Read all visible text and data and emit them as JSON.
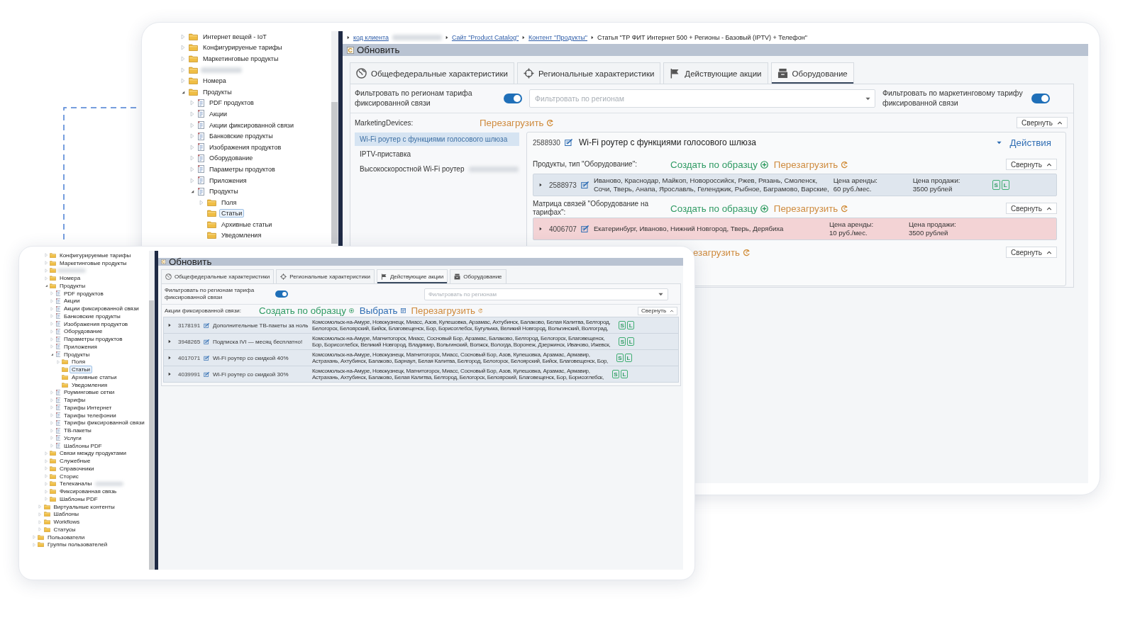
{
  "back_window": {
    "tree": [
      {
        "label": "Интернет вещей - IoT",
        "kind": "folder",
        "expandable": true,
        "expanded": false,
        "selected": false
      },
      {
        "label": "Конфигурируеные тарифы",
        "kind": "folder",
        "expandable": true,
        "expanded": false,
        "selected": false
      },
      {
        "label": "Маркетинговые продукты",
        "kind": "folder",
        "expandable": true,
        "expanded": false,
        "selected": false
      },
      {
        "kind": "folder",
        "expandable": true,
        "expanded": false,
        "redacted": true
      },
      {
        "label": "Номера",
        "kind": "folder",
        "expandable": true,
        "expanded": false,
        "selected": false
      },
      {
        "label": "Продукты",
        "kind": "folder",
        "expandable": true,
        "expanded": true,
        "selected": false,
        "children": [
          {
            "label": "PDF продуктов",
            "kind": "doc",
            "expandable": true,
            "expanded": false,
            "selected": false
          },
          {
            "label": "Акции",
            "kind": "doc",
            "expandable": true,
            "expanded": false,
            "selected": false
          },
          {
            "label": "Акции фиксированной связи",
            "kind": "doc",
            "expandable": true,
            "expanded": false,
            "selected": false
          },
          {
            "label": "Банковские продукты",
            "kind": "doc",
            "expandable": true,
            "expanded": false,
            "selected": false
          },
          {
            "label": "Изображения продуктов",
            "kind": "doc",
            "expandable": true,
            "expanded": false,
            "selected": false
          },
          {
            "label": "Оборудование",
            "kind": "doc",
            "expandable": true,
            "expanded": false,
            "selected": false
          },
          {
            "label": "Параметры продуктов",
            "kind": "doc",
            "expandable": true,
            "expanded": false,
            "selected": false
          },
          {
            "label": "Приложения",
            "kind": "doc",
            "expandable": true,
            "expanded": false,
            "selected": false
          },
          {
            "label": "Продукты",
            "kind": "doc",
            "expandable": true,
            "expanded": true,
            "selected": false,
            "children": [
              {
                "label": "Поля",
                "kind": "folder",
                "expandable": true,
                "expanded": false,
                "selected": false
              },
              {
                "label": "Статьи",
                "kind": "folder",
                "expandable": false,
                "selected": true
              },
              {
                "label": "Архивные статьи",
                "kind": "folder",
                "expandable": false,
                "selected": false
              },
              {
                "label": "Уведомления",
                "kind": "folder",
                "expandable": false,
                "selected": false
              }
            ]
          }
        ]
      }
    ],
    "breadcrumb": [
      {
        "text": "код клиента",
        "kind": "link",
        "redacted": true
      },
      {
        "text": "Сайт \"Product Catalog\"",
        "kind": "link"
      },
      {
        "text": "Контент \"Продукты\"",
        "kind": "link"
      },
      {
        "text": "Статья \"ТР ФИТ Интернет 500 + Регионы - Базовый (IPTV) + Телефон\"",
        "kind": "current"
      }
    ],
    "toolbar": {
      "refresh": "Обновить"
    },
    "tabs": [
      {
        "label": "Общефедеральные характеристики",
        "selected": false
      },
      {
        "label": "Региональные характеристики",
        "selected": false
      },
      {
        "label": "Действующие акции",
        "selected": false
      },
      {
        "label": "Оборудование",
        "selected": true
      }
    ],
    "filters": {
      "region_label": "Фильтровать по регионам тарифа фиксированной связи",
      "region_toggle_on": true,
      "region_placeholder": "Фильтровать по регионам",
      "marketing_label": "Фильтровать по маркетинговому тарифу фиксированной связи",
      "marketing_toggle_on": true
    },
    "devices": {
      "label": "MarketingDevices:",
      "reload": "Перезагрузить",
      "collapse": "Свернуть",
      "items": [
        {
          "label": "Wi-Fi роутер с функциями голосового шлюза",
          "selected": true,
          "redacted": false
        },
        {
          "label": "IPTV-приставка",
          "selected": false,
          "redacted": false
        },
        {
          "label": "Высокоскоростной Wi-Fi роутер",
          "selected": false,
          "redacted": true
        }
      ]
    },
    "detail": {
      "id": "2588930",
      "title": "Wi-Fi роутер с функциями голосового шлюза",
      "actions": "Действия",
      "sections": [
        {
          "label": "Продукты, тип \"Оборудование\":",
          "create": "Создать по образцу",
          "reload": "Перезагрузить",
          "collapse": "Свернуть",
          "rows": [
            {
              "id": "2588973",
              "regions": [
                "Иваново, Краснодар, Майкоп, Новороссийск, Ржев, Рязань, Смоленск,",
                "Сочи, Тверь, Анапа, Ярославль, Геленджик, Рыбное, Баграмово, Варские,"
              ],
              "rent_label": "Цена аренды:",
              "rent": "60 руб./мес.",
              "sale_label": "Цена продажи:",
              "sale": "3500 рублей",
              "badges": [
                "S",
                "L"
              ],
              "color": "#dfe6ee"
            }
          ]
        },
        {
          "label": "Матрица связей \"Оборудование на тарифах\":",
          "create": "Создать по образцу",
          "reload": "Перезагрузить",
          "collapse": "Свернуть",
          "rows": [
            {
              "id": "4006707",
              "regions": [
                "Екатеринбург, Иваново, Нижний Новгород, Тверь, Дерябиха"
              ],
              "rent_label": "Цена аренды:",
              "rent": "10 руб./мес.",
              "sale_label": "Цена продажи:",
              "sale": "3500 рублей",
              "color": "#f3d3d5"
            }
          ]
        },
        {
          "reload": "езагрузить",
          "collapse": "Свернуть"
        }
      ]
    }
  },
  "front_window": {
    "tree": [
      {
        "children": [
          {
            "children": [
              {
                "label": "Конфигурируемые тарифы",
                "kind": "folder",
                "expandable": true,
                "expanded": false,
                "selected": false
              },
              {
                "label": "Маркетинговые продукты",
                "kind": "folder",
                "expandable": true,
                "expanded": false,
                "selected": false
              },
              {
                "kind": "folder",
                "expandable": true,
                "expanded": false,
                "redacted": true
              },
              {
                "label": "Номера",
                "kind": "folder",
                "expandable": true,
                "expanded": false,
                "selected": false
              },
              {
                "label": "Продукты",
                "kind": "folder",
                "expandable": true,
                "expanded": true,
                "selected": false,
                "children": [
                  {
                    "label": "PDF продуктов",
                    "kind": "doc",
                    "expandable": true,
                    "expanded": false,
                    "selected": false
                  },
                  {
                    "label": "Акции",
                    "kind": "doc",
                    "expandable": true,
                    "expanded": false,
                    "selected": false
                  },
                  {
                    "label": "Акции фиксированной связи",
                    "kind": "doc",
                    "expandable": true,
                    "expanded": false,
                    "selected": false
                  },
                  {
                    "label": "Банковские продукты",
                    "kind": "doc",
                    "expandable": true,
                    "expanded": false,
                    "selected": false
                  },
                  {
                    "label": "Изображения продуктов",
                    "kind": "doc",
                    "expandable": true,
                    "expanded": false,
                    "selected": false
                  },
                  {
                    "label": "Оборудование",
                    "kind": "doc",
                    "expandable": true,
                    "expanded": false,
                    "selected": false
                  },
                  {
                    "label": "Параметры продуктов",
                    "kind": "doc",
                    "expandable": true,
                    "expanded": false,
                    "selected": false
                  },
                  {
                    "label": "Приложения",
                    "kind": "doc",
                    "expandable": true,
                    "expanded": false,
                    "selected": false
                  },
                  {
                    "label": "Продукты",
                    "kind": "doc",
                    "expandable": true,
                    "expanded": true,
                    "selected": false,
                    "children": [
                      {
                        "label": "Поля",
                        "kind": "folder",
                        "expandable": true,
                        "expanded": false,
                        "selected": false
                      },
                      {
                        "label": "Статьи",
                        "kind": "folder",
                        "expandable": false,
                        "selected": true
                      },
                      {
                        "label": "Архивные статьи",
                        "kind": "folder",
                        "expandable": false,
                        "selected": false
                      },
                      {
                        "label": "Уведомления",
                        "kind": "folder",
                        "expandable": false,
                        "selected": false
                      }
                    ]
                  },
                  {
                    "label": "Роуминговые сетки",
                    "kind": "doc",
                    "expandable": true,
                    "expanded": false,
                    "selected": false
                  },
                  {
                    "label": "Тарифы",
                    "kind": "doc",
                    "expandable": true,
                    "expanded": false,
                    "selected": false
                  },
                  {
                    "label": "Тарифы Интернет",
                    "kind": "doc",
                    "expandable": true,
                    "expanded": false,
                    "selected": false
                  },
                  {
                    "label": "Тарифы телефонии",
                    "kind": "doc",
                    "expandable": true,
                    "expanded": false,
                    "selected": false
                  },
                  {
                    "label": "Тарифы фиксированной связи",
                    "kind": "doc",
                    "expandable": true,
                    "expanded": false,
                    "selected": false
                  },
                  {
                    "label": "ТВ-пакеты",
                    "kind": "doc",
                    "expandable": true,
                    "expanded": false,
                    "selected": false
                  },
                  {
                    "label": "Услуги",
                    "kind": "doc",
                    "expandable": true,
                    "expanded": false,
                    "selected": false
                  },
                  {
                    "label": "Шаблоны PDF",
                    "kind": "doc",
                    "expandable": true,
                    "expanded": false,
                    "selected": false
                  }
                ]
              },
              {
                "label": "Связи между продуктами",
                "kind": "folder",
                "expandable": true,
                "expanded": false,
                "selected": false
              },
              {
                "label": "Служебные",
                "kind": "folder",
                "expandable": true,
                "expanded": false,
                "selected": false
              },
              {
                "label": "Справочники",
                "kind": "folder",
                "expandable": true,
                "expanded": false,
                "selected": false
              },
              {
                "label": "Сторис",
                "kind": "folder",
                "expandable": true,
                "expanded": false,
                "selected": false
              },
              {
                "label": "Телеканалы",
                "kind": "folder",
                "expandable": true,
                "expanded": false,
                "selected": false,
                "redacted": true
              },
              {
                "label": "Фиксированная связь",
                "kind": "folder",
                "expandable": true,
                "expanded": false,
                "selected": false
              },
              {
                "label": "Шаблоны PDF",
                "kind": "folder",
                "expandable": true,
                "expanded": false,
                "selected": false
              }
            ]
          },
          {
            "label": "Виртуальные контенты",
            "kind": "folder",
            "expandable": true,
            "expanded": false,
            "selected": false
          },
          {
            "label": "Шаблоны",
            "kind": "folder",
            "expandable": true,
            "expanded": false,
            "selected": false
          },
          {
            "label": "Workflows",
            "kind": "folder",
            "expandable": true,
            "expanded": false,
            "selected": false
          },
          {
            "label": "Статусы",
            "kind": "folder",
            "expandable": true,
            "expanded": false,
            "selected": false
          }
        ]
      },
      {
        "label": "Пользователи",
        "kind": "folder",
        "expandable": true,
        "expanded": false,
        "selected": false
      },
      {
        "label": "Группы пользователей",
        "kind": "folder",
        "expandable": true,
        "expanded": false,
        "selected": false
      }
    ],
    "toolbar": {
      "refresh": "Обновить"
    },
    "tabs": [
      {
        "label": "Общефедеральные характеристики",
        "selected": false
      },
      {
        "label": "Региональные характеристики",
        "selected": false
      },
      {
        "label": "Действующие акции",
        "selected": true
      },
      {
        "label": "Оборудование",
        "selected": false
      }
    ],
    "filter": {
      "label": "Фильтровать по регионам тарифа фиксированной связи",
      "toggle_on": true,
      "placeholder": "Фильтровать по регионам"
    },
    "promotions": {
      "label": "Акции фиксированной связи:",
      "create": "Создать по образцу",
      "choose": "Выбрать",
      "reload": "Перезагрузить",
      "collapse": "Свернуть",
      "rows": [
        {
          "id": "3178191",
          "name": "Дополнительные ТВ-пакеты за ноль",
          "regions": [
            "Комсомольск-на-Амуре, Новокузнецк, Миасс, Азов, Кулешовка, Арзамас, Ахтубинск, Балаково, Белая Калитва, Белгород,",
            "Белогорск, Белоярский, Бийск, Благовещенск, Бор, Борисоглебск, Бугульма, Великий Новгород, Вольгинский, Волгоград,"
          ],
          "badges": [
            "S",
            "L"
          ]
        },
        {
          "id": "3948265",
          "name": "Подписка IVI — месяц бесплатно!",
          "regions": [
            "Комсомольск-на-Амуре, Магнитогорск, Миасс, Сосновый Бор, Арзамас, Балаково, Белгород, Белогорск, Благовещенск,",
            "Бор, Борисоглебск, Великий Новгород, Владимир, Вольгинский, Волжск, Вологда, Воронеж, Дзержинск, Иваново, Ижевск,"
          ],
          "badges": [
            "S",
            "L"
          ]
        },
        {
          "id": "4017071",
          "name": "Wi-Fi роутер со скидкой 40%",
          "regions": [
            "Комсомольск-на-Амуре, Новокузнецк, Магнитогорск, Миасс, Сосновый Бор, Азов, Кулешовка, Арзамас, Армавир,",
            "Астрахань, Ахтубинск, Балаково, Барнаул, Белая Калитва, Белгород, Белогорск, Белоярский, Бийск, Благовещенск, Бор,"
          ],
          "badges": [
            "S",
            "L"
          ]
        },
        {
          "id": "4039991",
          "name": "Wi-Fi роутер со скидкой 30%",
          "regions": [
            "Комсомольск-на-Амуре, Новокузнецк, Магнитогорск, Миасс, Сосновый Бор, Азов, Кулешовка, Арзамас, Армавир,",
            "Астрахань, Ахтубинск, Балаково, Белая Калитва, Белгород, Белогорск, Белоярский, Благовещенск, Бор, Борисоглебск,"
          ],
          "badges": [
            "S",
            "L"
          ]
        }
      ]
    }
  }
}
